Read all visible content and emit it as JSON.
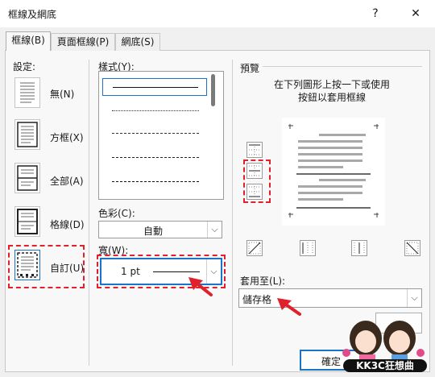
{
  "window": {
    "title": "框線及網底",
    "help_glyph": "?",
    "close_glyph": "✕"
  },
  "tabs": [
    {
      "label": "框線(B)"
    },
    {
      "label": "頁面框線(P)"
    },
    {
      "label": "網底(S)"
    }
  ],
  "settings": {
    "heading": "設定:",
    "presets": [
      {
        "label": "無(N)",
        "icon": "no-border-icon"
      },
      {
        "label": "方框(X)",
        "icon": "box-border-icon"
      },
      {
        "label": "全部(A)",
        "icon": "all-borders-icon"
      },
      {
        "label": "格線(D)",
        "icon": "grid-borders-icon"
      },
      {
        "label": "自訂(U)",
        "icon": "custom-border-icon"
      }
    ]
  },
  "style": {
    "heading": "樣式(Y):",
    "items": [
      "solid",
      "dotted",
      "dashed-small",
      "dashed-medium",
      "dash-dot",
      "dash-dot-large"
    ]
  },
  "color": {
    "label": "色彩(C):",
    "value": "自動"
  },
  "width": {
    "label": "寬(W):",
    "value": "1 pt"
  },
  "preview": {
    "heading": "預覽",
    "instruction_line1": "在下列圖形上按一下或使用",
    "instruction_line2": "按鈕以套用框線"
  },
  "apply_to": {
    "label": "套用至(L):",
    "value": "儲存格"
  },
  "buttons": {
    "ok": "確定"
  },
  "watermark": {
    "text": "KK3C狂想曲"
  },
  "colors": {
    "accent": "#1a73c8",
    "highlight": "#e0202a"
  }
}
